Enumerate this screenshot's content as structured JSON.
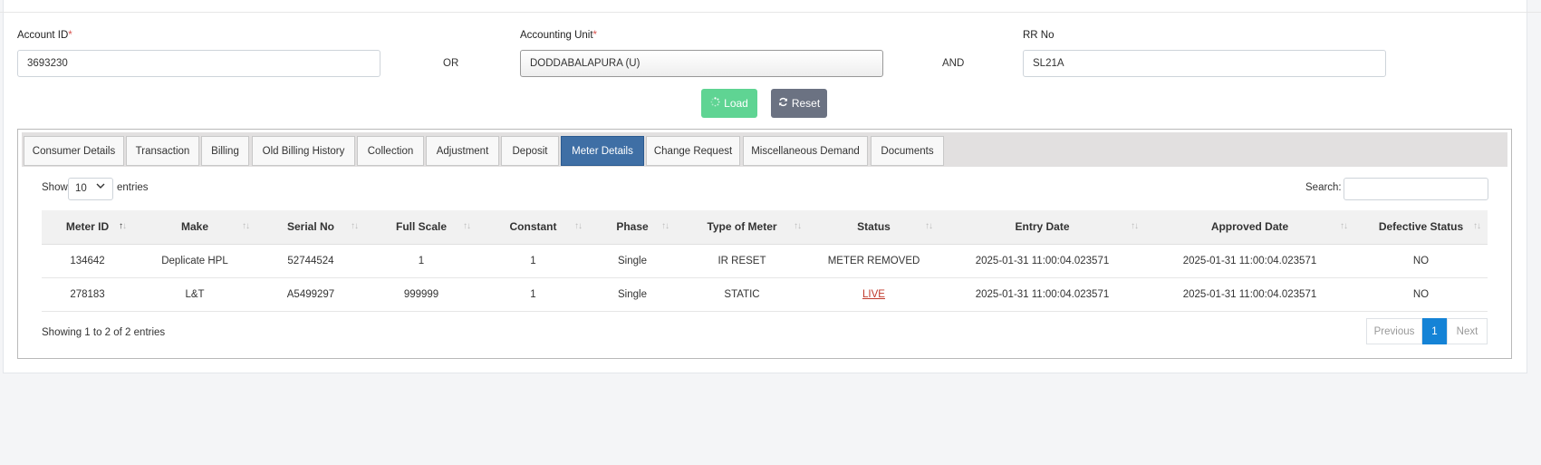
{
  "form": {
    "account_id_label": "Account ID",
    "account_id_value": "3693230",
    "or_text": "OR",
    "accounting_unit_label": "Accounting Unit",
    "accounting_unit_value": "DODDABALAPURA (U)",
    "and_text": "AND",
    "rr_no_label": "RR No",
    "rr_no_value": "SL21A",
    "required_mark": "*",
    "load_label": "Load",
    "reset_label": "Reset"
  },
  "tabs": [
    {
      "label": "Consumer Details"
    },
    {
      "label": "Transaction"
    },
    {
      "label": "Billing"
    },
    {
      "label": "Old Billing History"
    },
    {
      "label": "Collection"
    },
    {
      "label": "Adjustment"
    },
    {
      "label": "Deposit"
    },
    {
      "label": "Meter Details",
      "active": true
    },
    {
      "label": "Change Request"
    },
    {
      "label": "Miscellaneous Demand"
    },
    {
      "label": "Documents"
    }
  ],
  "table_controls": {
    "show_label": "Show",
    "entries_value": "10",
    "entries_label": "entries",
    "search_label": "Search:"
  },
  "table": {
    "columns": [
      "Meter ID",
      "Make",
      "Serial No",
      "Full Scale",
      "Constant",
      "Phase",
      "Type of Meter",
      "Status",
      "Entry Date",
      "Approved Date",
      "Defective Status"
    ],
    "rows": [
      [
        "134642",
        "Deplicate HPL",
        "52744524",
        "1",
        "1",
        "Single",
        "IR RESET",
        "METER REMOVED",
        "2025-01-31 11:00:04.023571",
        "2025-01-31 11:00:04.023571",
        "NO"
      ],
      [
        "278183",
        "L&T",
        "A5499297",
        "999999",
        "1",
        "Single",
        "STATIC",
        "LIVE",
        "2025-01-31 11:00:04.023571",
        "2025-01-31 11:00:04.023571",
        "NO"
      ]
    ]
  },
  "footer": {
    "info": "Showing 1 to 2 of 2 entries",
    "previous": "Previous",
    "page": "1",
    "next": "Next"
  },
  "colors": {
    "active_tab": "#3f6fa5",
    "load_button": "#5fd493",
    "reset_button": "#6b7282",
    "live_status": "#c0392b",
    "current_page": "#1583d6"
  }
}
